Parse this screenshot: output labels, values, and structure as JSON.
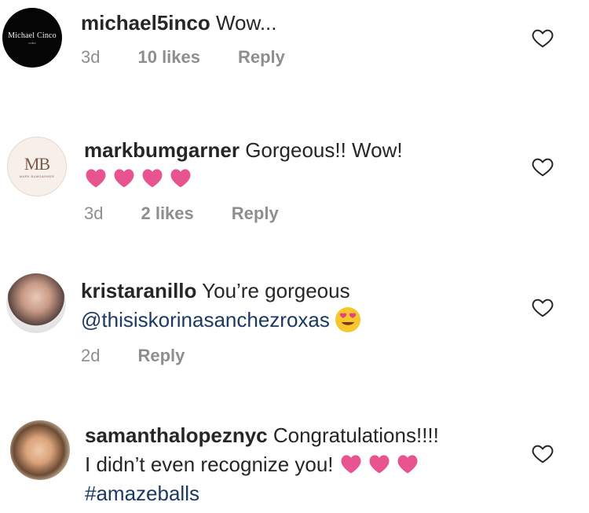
{
  "comments": [
    {
      "username": "michael5inco",
      "text": " Wow...",
      "time": "3d",
      "likes": "10 likes",
      "reply": "Reply",
      "avatar_logo": "Michael Cinco",
      "avatar_sub": "DUBAI"
    },
    {
      "username": "markbumgarner",
      "text": " Gorgeous!! Wow!",
      "emoji": [
        "pink-heart",
        "pink-heart",
        "pink-heart",
        "pink-heart"
      ],
      "time": "3d",
      "likes": "2 likes",
      "reply": "Reply",
      "avatar_logo": "MB",
      "avatar_sub": "MARK BUMGARNER"
    },
    {
      "username": "kristaranillo",
      "text": " You’re gorgeous",
      "mention": "@thisiskorinasanchezroxas",
      "emoji": [
        "heart-eyes-face"
      ],
      "time": "2d",
      "reply": "Reply"
    },
    {
      "username": "samanthalopeznyc",
      "text": " Congratulations!!!!",
      "line2": "I didn’t even recognize you!",
      "emoji": [
        "pink-heart",
        "pink-heart",
        "pink-heart"
      ],
      "hashtag": "#amazeballs"
    }
  ],
  "colors": {
    "heart": "#e8548f",
    "mention": "#1b3a63",
    "meta": "#8e8e8e"
  }
}
